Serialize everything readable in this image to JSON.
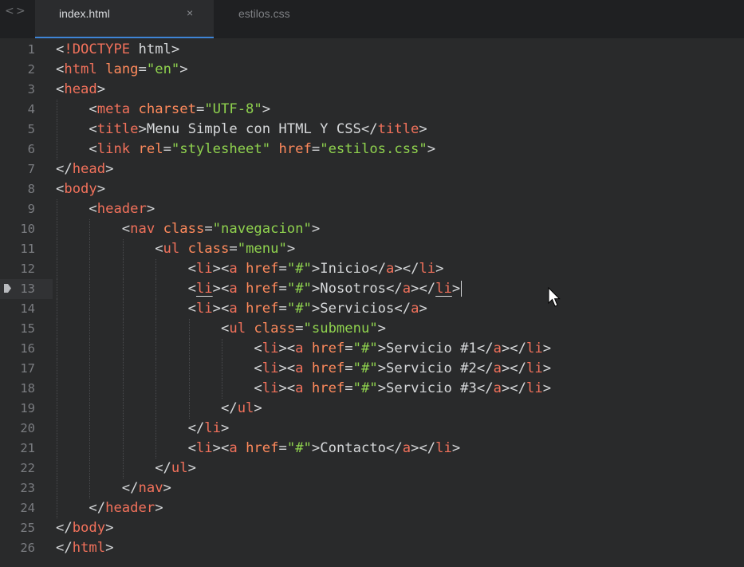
{
  "nav": {
    "back_glyph": "<",
    "forward_glyph": ">"
  },
  "tabs": [
    {
      "label": "index.html",
      "active": true,
      "close_glyph": "×"
    },
    {
      "label": "estilos.css",
      "active": false
    }
  ],
  "editor": {
    "current_line": 13,
    "bookmark_line": 13,
    "lines": [
      {
        "n": "1",
        "indent": 0,
        "tokens": [
          [
            "p",
            "<"
          ],
          [
            "t",
            "!DOCTYPE"
          ],
          [
            "p",
            " html>"
          ]
        ]
      },
      {
        "n": "2",
        "indent": 0,
        "tokens": [
          [
            "p",
            "<"
          ],
          [
            "t",
            "html"
          ],
          [
            "p",
            " "
          ],
          [
            "a",
            "lang"
          ],
          [
            "p",
            "="
          ],
          [
            "s",
            "\"en\""
          ],
          [
            "p",
            ">"
          ]
        ]
      },
      {
        "n": "3",
        "indent": 0,
        "tokens": [
          [
            "p",
            "<"
          ],
          [
            "t",
            "head"
          ],
          [
            "p",
            ">"
          ]
        ]
      },
      {
        "n": "4",
        "indent": 1,
        "tokens": [
          [
            "p",
            "<"
          ],
          [
            "t",
            "meta"
          ],
          [
            "p",
            " "
          ],
          [
            "a",
            "charset"
          ],
          [
            "p",
            "="
          ],
          [
            "s",
            "\"UTF-8\""
          ],
          [
            "p",
            ">"
          ]
        ]
      },
      {
        "n": "5",
        "indent": 1,
        "tokens": [
          [
            "p",
            "<"
          ],
          [
            "t",
            "title"
          ],
          [
            "p",
            ">"
          ],
          [
            "x",
            "Menu Simple con HTML Y CSS"
          ],
          [
            "p",
            "</"
          ],
          [
            "t",
            "title"
          ],
          [
            "p",
            ">"
          ]
        ]
      },
      {
        "n": "6",
        "indent": 1,
        "tokens": [
          [
            "p",
            "<"
          ],
          [
            "t",
            "link"
          ],
          [
            "p",
            " "
          ],
          [
            "a",
            "rel"
          ],
          [
            "p",
            "="
          ],
          [
            "s",
            "\"stylesheet\""
          ],
          [
            "p",
            " "
          ],
          [
            "a",
            "href"
          ],
          [
            "p",
            "="
          ],
          [
            "s",
            "\"estilos.css\""
          ],
          [
            "p",
            ">"
          ]
        ]
      },
      {
        "n": "7",
        "indent": 0,
        "tokens": [
          [
            "p",
            "</"
          ],
          [
            "t",
            "head"
          ],
          [
            "p",
            ">"
          ]
        ]
      },
      {
        "n": "8",
        "indent": 0,
        "tokens": [
          [
            "p",
            "<"
          ],
          [
            "t",
            "body"
          ],
          [
            "p",
            ">"
          ]
        ]
      },
      {
        "n": "9",
        "indent": 1,
        "tokens": [
          [
            "p",
            "<"
          ],
          [
            "t",
            "header"
          ],
          [
            "p",
            ">"
          ]
        ]
      },
      {
        "n": "10",
        "indent": 2,
        "tokens": [
          [
            "p",
            "<"
          ],
          [
            "t",
            "nav"
          ],
          [
            "p",
            " "
          ],
          [
            "a",
            "class"
          ],
          [
            "p",
            "="
          ],
          [
            "s",
            "\"navegacion\""
          ],
          [
            "p",
            ">"
          ]
        ]
      },
      {
        "n": "11",
        "indent": 3,
        "tokens": [
          [
            "p",
            "<"
          ],
          [
            "t",
            "ul"
          ],
          [
            "p",
            " "
          ],
          [
            "a",
            "class"
          ],
          [
            "p",
            "="
          ],
          [
            "s",
            "\"menu\""
          ],
          [
            "p",
            ">"
          ]
        ]
      },
      {
        "n": "12",
        "indent": 4,
        "tokens": [
          [
            "p",
            "<"
          ],
          [
            "t",
            "li"
          ],
          [
            "p",
            "><"
          ],
          [
            "t",
            "a"
          ],
          [
            "p",
            " "
          ],
          [
            "a",
            "href"
          ],
          [
            "p",
            "="
          ],
          [
            "s",
            "\"#\""
          ],
          [
            "p",
            ">"
          ],
          [
            "x",
            "Inicio"
          ],
          [
            "p",
            "</"
          ],
          [
            "t",
            "a"
          ],
          [
            "p",
            "></"
          ],
          [
            "t",
            "li"
          ],
          [
            "p",
            ">"
          ]
        ]
      },
      {
        "n": "13",
        "indent": 4,
        "tokens": [
          [
            "p",
            "<"
          ],
          [
            "tu",
            "li"
          ],
          [
            "p",
            "><"
          ],
          [
            "t",
            "a"
          ],
          [
            "p",
            " "
          ],
          [
            "a",
            "href"
          ],
          [
            "p",
            "="
          ],
          [
            "s",
            "\"#\""
          ],
          [
            "p",
            ">"
          ],
          [
            "x",
            "Nosotros"
          ],
          [
            "p",
            "</"
          ],
          [
            "t",
            "a"
          ],
          [
            "p",
            "></"
          ],
          [
            "tu",
            "li"
          ],
          [
            "p",
            ">"
          ],
          [
            "caret",
            ""
          ]
        ]
      },
      {
        "n": "14",
        "indent": 4,
        "tokens": [
          [
            "p",
            "<"
          ],
          [
            "t",
            "li"
          ],
          [
            "p",
            "><"
          ],
          [
            "t",
            "a"
          ],
          [
            "p",
            " "
          ],
          [
            "a",
            "href"
          ],
          [
            "p",
            "="
          ],
          [
            "s",
            "\"#\""
          ],
          [
            "p",
            ">"
          ],
          [
            "x",
            "Servicios"
          ],
          [
            "p",
            "</"
          ],
          [
            "t",
            "a"
          ],
          [
            "p",
            ">"
          ]
        ]
      },
      {
        "n": "15",
        "indent": 5,
        "tokens": [
          [
            "p",
            "<"
          ],
          [
            "t",
            "ul"
          ],
          [
            "p",
            " "
          ],
          [
            "a",
            "class"
          ],
          [
            "p",
            "="
          ],
          [
            "s",
            "\"submenu\""
          ],
          [
            "p",
            ">"
          ]
        ]
      },
      {
        "n": "16",
        "indent": 6,
        "tokens": [
          [
            "p",
            "<"
          ],
          [
            "t",
            "li"
          ],
          [
            "p",
            "><"
          ],
          [
            "t",
            "a"
          ],
          [
            "p",
            " "
          ],
          [
            "a",
            "href"
          ],
          [
            "p",
            "="
          ],
          [
            "s",
            "\"#\""
          ],
          [
            "p",
            ">"
          ],
          [
            "x",
            "Servicio #1"
          ],
          [
            "p",
            "</"
          ],
          [
            "t",
            "a"
          ],
          [
            "p",
            "></"
          ],
          [
            "t",
            "li"
          ],
          [
            "p",
            ">"
          ]
        ]
      },
      {
        "n": "17",
        "indent": 6,
        "tokens": [
          [
            "p",
            "<"
          ],
          [
            "t",
            "li"
          ],
          [
            "p",
            "><"
          ],
          [
            "t",
            "a"
          ],
          [
            "p",
            " "
          ],
          [
            "a",
            "href"
          ],
          [
            "p",
            "="
          ],
          [
            "s",
            "\"#\""
          ],
          [
            "p",
            ">"
          ],
          [
            "x",
            "Servicio #2"
          ],
          [
            "p",
            "</"
          ],
          [
            "t",
            "a"
          ],
          [
            "p",
            "></"
          ],
          [
            "t",
            "li"
          ],
          [
            "p",
            ">"
          ]
        ]
      },
      {
        "n": "18",
        "indent": 6,
        "tokens": [
          [
            "p",
            "<"
          ],
          [
            "t",
            "li"
          ],
          [
            "p",
            "><"
          ],
          [
            "t",
            "a"
          ],
          [
            "p",
            " "
          ],
          [
            "a",
            "href"
          ],
          [
            "p",
            "="
          ],
          [
            "s",
            "\"#\""
          ],
          [
            "p",
            ">"
          ],
          [
            "x",
            "Servicio #3"
          ],
          [
            "p",
            "</"
          ],
          [
            "t",
            "a"
          ],
          [
            "p",
            "></"
          ],
          [
            "t",
            "li"
          ],
          [
            "p",
            ">"
          ]
        ]
      },
      {
        "n": "19",
        "indent": 5,
        "tokens": [
          [
            "p",
            "</"
          ],
          [
            "t",
            "ul"
          ],
          [
            "p",
            ">"
          ]
        ]
      },
      {
        "n": "20",
        "indent": 4,
        "tokens": [
          [
            "p",
            "</"
          ],
          [
            "t",
            "li"
          ],
          [
            "p",
            ">"
          ]
        ]
      },
      {
        "n": "21",
        "indent": 4,
        "tokens": [
          [
            "p",
            "<"
          ],
          [
            "t",
            "li"
          ],
          [
            "p",
            "><"
          ],
          [
            "t",
            "a"
          ],
          [
            "p",
            " "
          ],
          [
            "a",
            "href"
          ],
          [
            "p",
            "="
          ],
          [
            "s",
            "\"#\""
          ],
          [
            "p",
            ">"
          ],
          [
            "x",
            "Contacto"
          ],
          [
            "p",
            "</"
          ],
          [
            "t",
            "a"
          ],
          [
            "p",
            "></"
          ],
          [
            "t",
            "li"
          ],
          [
            "p",
            ">"
          ]
        ]
      },
      {
        "n": "22",
        "indent": 3,
        "tokens": [
          [
            "p",
            "</"
          ],
          [
            "t",
            "ul"
          ],
          [
            "p",
            ">"
          ]
        ]
      },
      {
        "n": "23",
        "indent": 2,
        "tokens": [
          [
            "p",
            "</"
          ],
          [
            "t",
            "nav"
          ],
          [
            "p",
            ">"
          ]
        ]
      },
      {
        "n": "24",
        "indent": 1,
        "tokens": [
          [
            "p",
            "</"
          ],
          [
            "t",
            "header"
          ],
          [
            "p",
            ">"
          ]
        ]
      },
      {
        "n": "25",
        "indent": 0,
        "tokens": [
          [
            "p",
            "</"
          ],
          [
            "t",
            "body"
          ],
          [
            "p",
            ">"
          ]
        ]
      },
      {
        "n": "26",
        "indent": 0,
        "tokens": [
          [
            "p",
            "</"
          ],
          [
            "t",
            "html"
          ],
          [
            "p",
            ">"
          ]
        ]
      }
    ]
  },
  "colors": {
    "background": "#292a2b",
    "tag": "#f1715b",
    "attribute": "#ff8a5c",
    "string": "#8fd24e",
    "text": "#d6d8da",
    "line_number": "#7a7c80",
    "tab_accent": "#3e84d6"
  }
}
